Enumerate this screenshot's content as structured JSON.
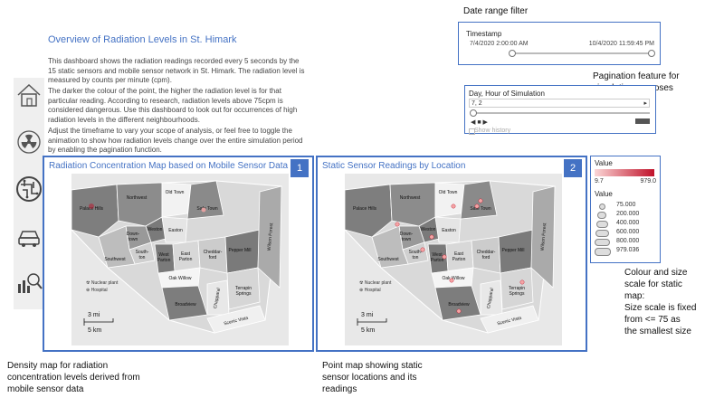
{
  "annotations": {
    "date_range": "Date range filter",
    "pagination_line1": "Pagination feature for",
    "pagination_line2": "simulation purposes",
    "legend_note": [
      "Colour and size",
      "scale for static",
      "map:",
      "Size scale is fixed",
      "from <= 75 as",
      "the smallest size"
    ],
    "density_note": [
      "Density map for radiation",
      "concentration levels derived from",
      "mobile sensor data"
    ],
    "point_note": [
      "Point map showing static",
      "sensor locations and its",
      "readings"
    ]
  },
  "intro": {
    "title": "Overview of Radiation Levels in St. Himark",
    "para1": "This dashboard shows the radiation readings recorded every 5 seconds by the 15 static sensors and mobile sensor network in St. Himark. The radiation level is measured by counts per minute (cpm).",
    "para2": "The darker the colour of the point, the higher the radiation level is for that particular reading. According to research, radiation levels above 75cpm is considered dangerous. Use this dashboard to look out for occurrences of high radiation levels in the different neighbourhoods.",
    "para3": "Adjust the timeframe to vary your scope of analysis, or feel free to toggle the animation to show how radiation levels change over the entire simulation period by enabling the pagination function."
  },
  "sidebar_icons": [
    "home-icon",
    "radiation-icon",
    "circuit-icon",
    "car-icon",
    "analytics-icon"
  ],
  "timestamp_filter": {
    "label": "Timestamp",
    "start": "7/4/2020 2:00:00 AM",
    "end": "10/4/2020 11:59:45 PM",
    "range": [
      0,
      1
    ]
  },
  "pagination": {
    "label": "Day, Hour of Simulation",
    "value": "7, 2",
    "controls": "◀ ■ ▶",
    "show_history": "Show history"
  },
  "maps": [
    {
      "title": "Radiation Concentration Map based on Mobile Sensor Data",
      "number": "1"
    },
    {
      "title": "Static Sensor Readings by Location",
      "number": "2"
    }
  ],
  "map_labels": {
    "palace_hills": "Palace Hills",
    "northwest": "Northwest",
    "old_town": "Old Town",
    "safe_town": "Safe Town",
    "weston": "Weston",
    "downtown": "Down-\ntown",
    "easton": "Easton",
    "southton": "South-\nton",
    "southwest": "Southwest",
    "west_parton": "West\nParton",
    "east_parton": "East\nParton",
    "cheddarford": "Cheddar-\nford",
    "pepper_mill": "Pepper Mill",
    "wilson_forest": "Wilson Forest",
    "oak_willow": "Oak Willow",
    "nuclear_plant": "Nuclear plant",
    "hospital": "Hospital",
    "terrapin_springs": "Terrapin\nSprings",
    "broadview": "Broadview",
    "chapparal": "Chapparal",
    "scenic_vista": "Scenic Vista",
    "scale_mi": "3 mi",
    "scale_km": "5 km"
  },
  "legend": {
    "color_title": "Value",
    "color_min": "9.7",
    "color_max": "979.0",
    "size_title": "Value",
    "size_values": [
      "75.000",
      "200.000",
      "400.000",
      "600.000",
      "800.000",
      "979.036"
    ]
  },
  "colors": {
    "accent": "#4472c4",
    "hot": "#c0122a"
  }
}
